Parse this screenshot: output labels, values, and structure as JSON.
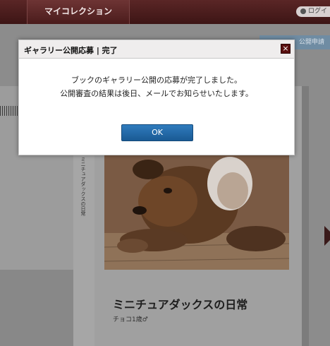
{
  "header": {
    "tab_label": "マイコレクション",
    "login_label": "ログイ"
  },
  "page": {
    "publish_button": "公開申請",
    "spine_text": "ミニチュアダックスの日常",
    "book_title": "ミニチュアダックスの日常",
    "book_author": "チョコ1歳♂"
  },
  "dialog": {
    "title": "ギャラリー公開応募 | 完了",
    "close_label": "×",
    "message_line1": "ブックのギャラリー公開の応募が完了しました。",
    "message_line2": "公開審査の結果は後日、メールでお知らせいたします。",
    "ok_label": "OK"
  }
}
